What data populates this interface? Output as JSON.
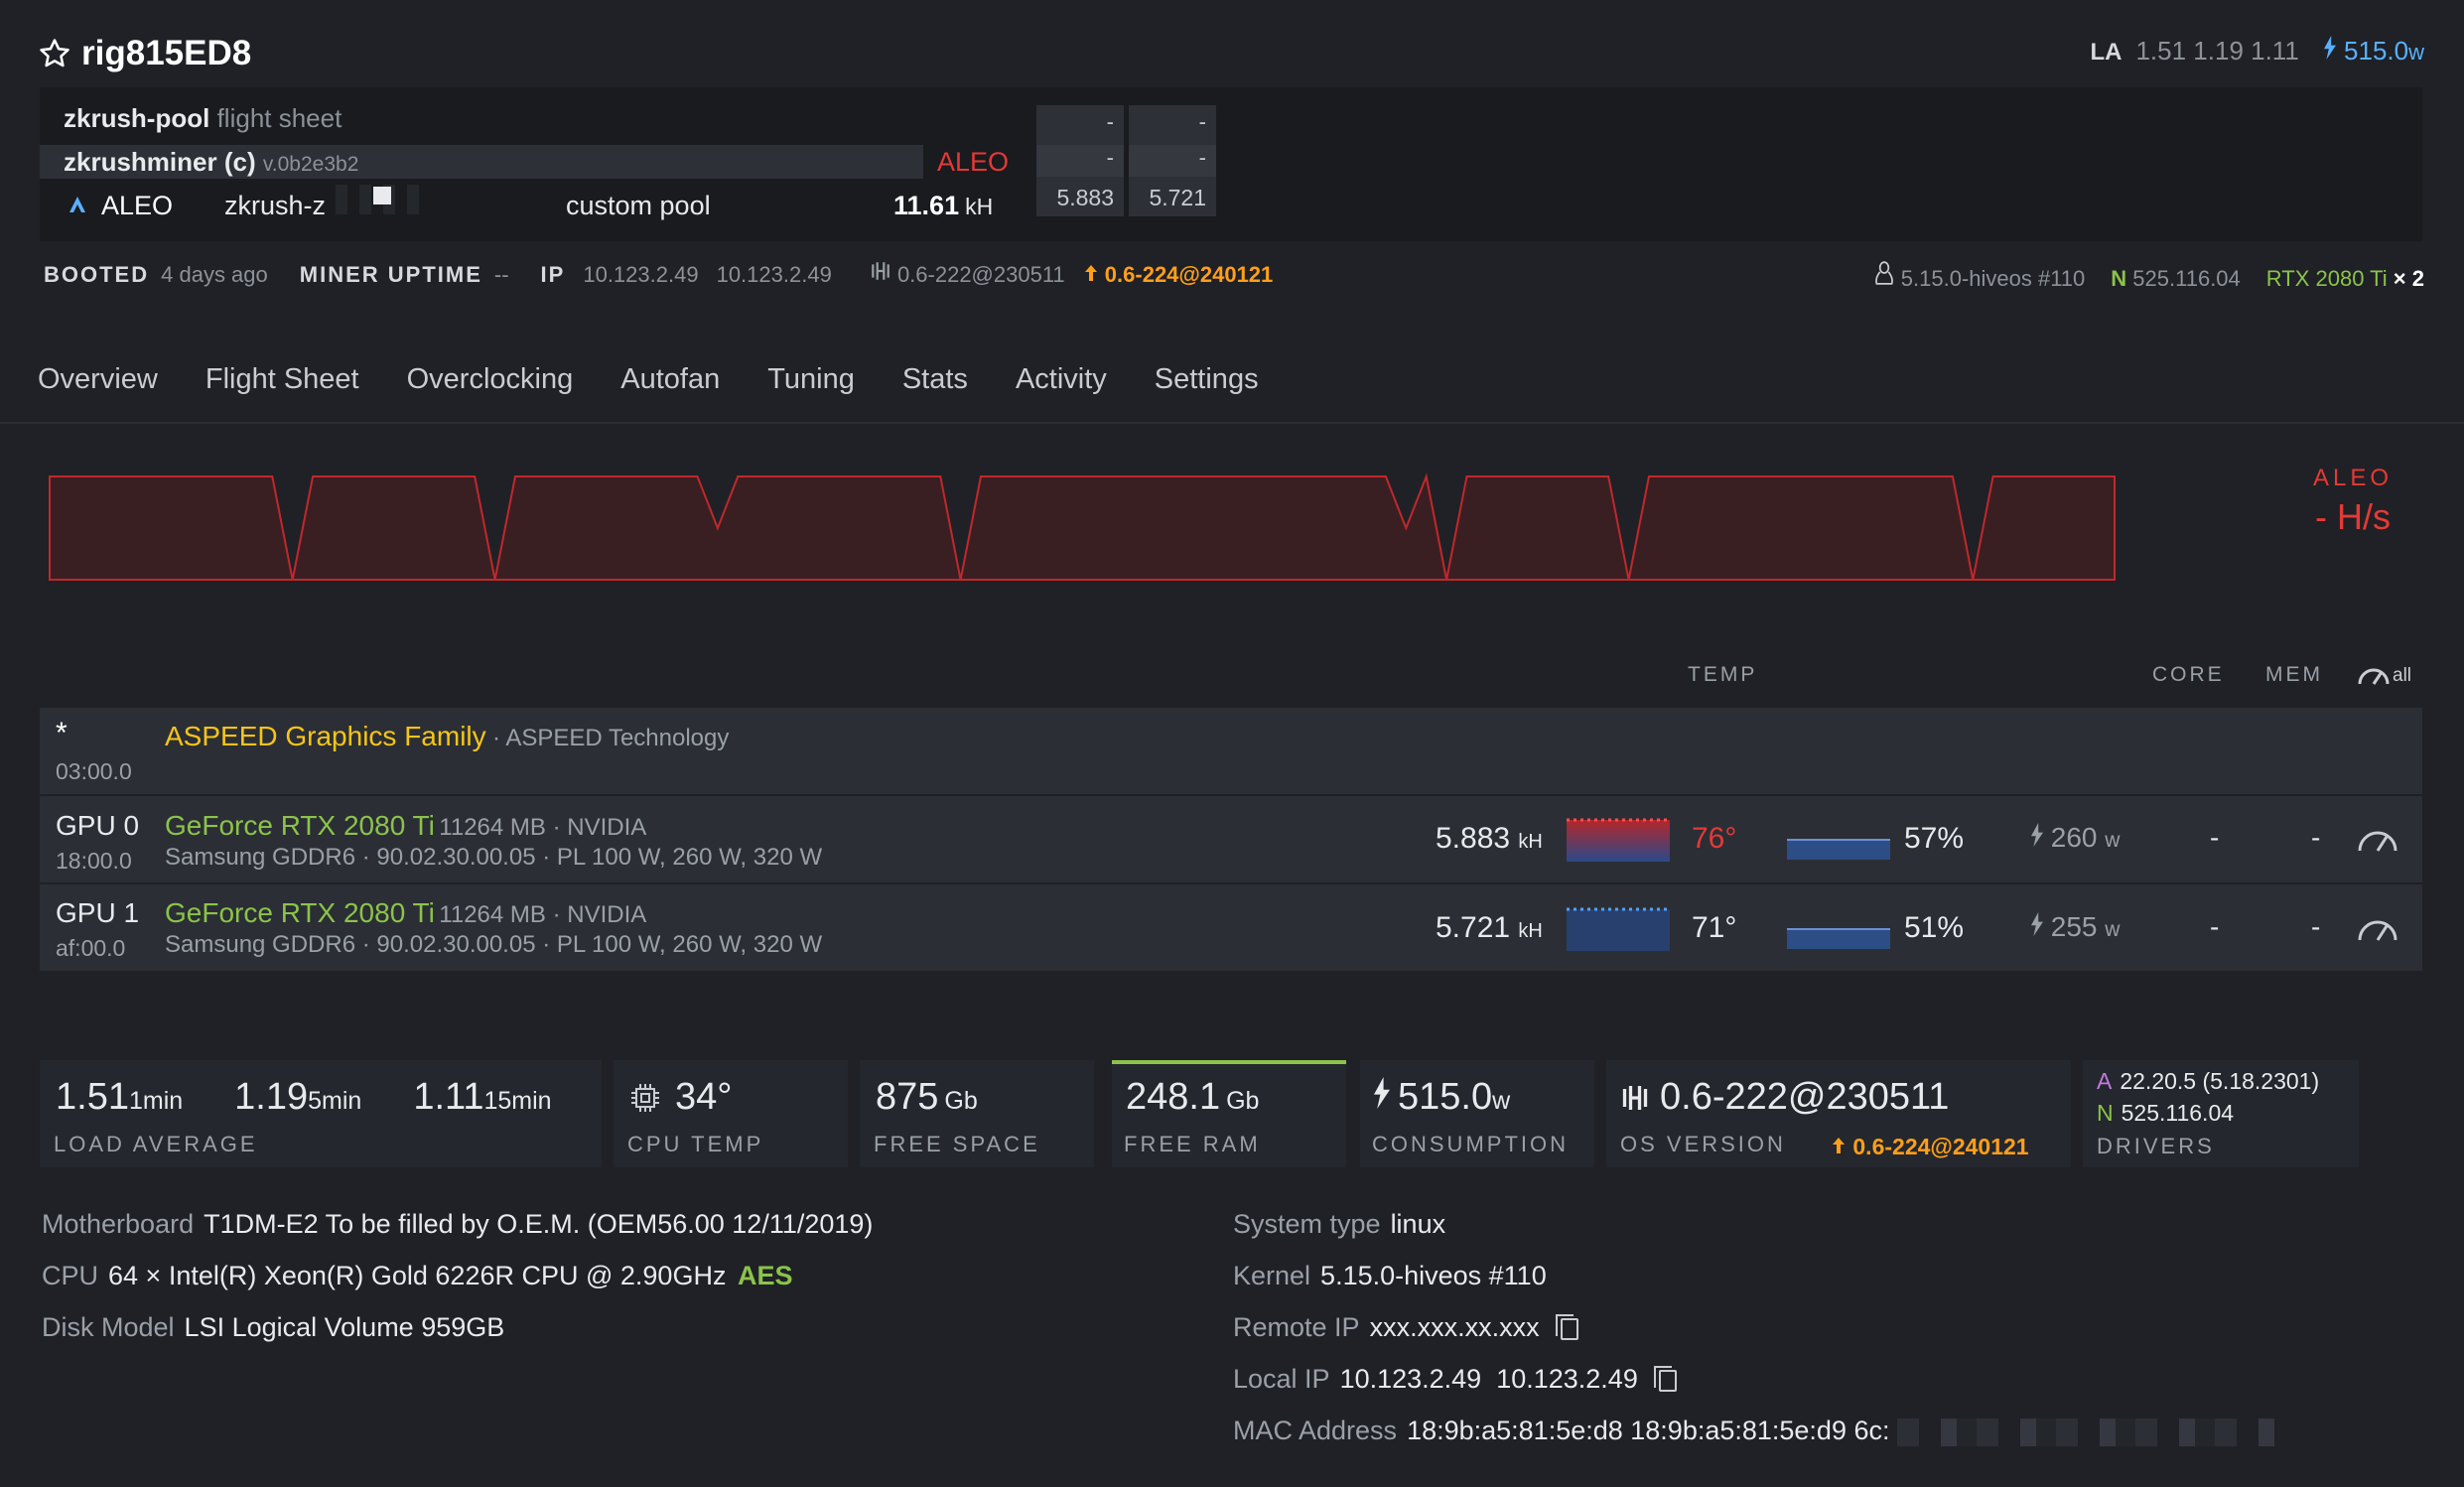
{
  "header": {
    "rig_name": "rig815ED8",
    "la_label": "LA",
    "la_values": "1.51 1.19 1.11",
    "power": "515.0",
    "power_unit": "w"
  },
  "flight_sheet": {
    "name": "zkrush-pool",
    "name_suffix": "flight sheet",
    "miner": "zkrushminer (c)",
    "miner_version": "v.0b2e3b2",
    "coin_tag": "ALEO",
    "coin": "ALEO",
    "wallet": "zkrush-z",
    "pool": "custom pool",
    "hashrate": "11.61",
    "hashrate_unit": "kH",
    "gpu_boxes": [
      {
        "top": "-",
        "mid": "-",
        "value": "5.883"
      },
      {
        "top": "-",
        "mid": "-",
        "value": "5.721"
      }
    ]
  },
  "status": {
    "booted_label": "BOOTED",
    "booted_value": "4 days ago",
    "uptime_label": "MINER UPTIME",
    "uptime_value": "--",
    "ip_label": "IP",
    "ip_value_1": "10.123.2.49",
    "ip_value_2": "10.123.2.49",
    "version": "0.6-222@230511",
    "version_upgrade": "0.6-224@240121",
    "kernel": "5.15.0-hiveos #110",
    "nvidia_driver": "525.116.04",
    "gpu_model": "RTX 2080 Ti",
    "gpu_count": "× 2"
  },
  "tabs": [
    "Overview",
    "Flight Sheet",
    "Overclocking",
    "Autofan",
    "Tuning",
    "Stats",
    "Activity",
    "Settings"
  ],
  "chart": {
    "coin": "ALEO",
    "current": "- H/s"
  },
  "chart_data": {
    "type": "area",
    "title": "",
    "series": [
      {
        "name": "ALEO",
        "values": [
          1,
          1,
          1,
          1,
          1,
          1,
          1,
          1,
          1,
          1,
          1,
          1,
          0,
          1,
          1,
          1,
          1,
          1,
          1,
          1,
          1,
          1,
          0,
          1,
          1,
          1,
          1,
          1,
          1,
          1,
          1,
          1,
          1,
          0.5,
          1,
          1,
          1,
          1,
          1,
          1,
          1,
          1,
          1,
          1,
          1,
          0,
          1,
          1,
          1,
          1,
          1,
          1,
          1,
          1,
          1,
          1,
          1,
          1,
          1,
          1,
          1,
          1,
          1,
          1,
          1,
          1,
          1,
          0.5,
          1,
          0,
          1,
          1,
          1,
          1,
          1,
          1,
          1,
          1,
          0,
          1,
          1,
          1,
          1,
          1,
          1,
          1,
          1,
          1,
          1,
          1,
          1,
          1,
          1,
          1,
          1,
          0,
          1,
          1,
          1,
          1,
          1,
          1,
          1
        ]
      }
    ]
  },
  "table": {
    "col_temp": "TEMP",
    "col_core": "CORE",
    "col_mem": "MEM",
    "all_label": "all"
  },
  "devices": [
    {
      "id": "*",
      "bus": "03:00.0",
      "name": "ASPEED Graphics Family",
      "vendor": "· ASPEED Technology"
    },
    {
      "id": "GPU 0",
      "bus": "18:00.0",
      "name": "GeForce RTX 2080 Ti",
      "mem": "11264 MB · NVIDIA",
      "details": "Samsung GDDR6 · 90.02.30.00.05 · PL 100 W, 260 W, 320 W",
      "hashrate": "5.883",
      "hash_unit": "kH",
      "temp": "76°",
      "temp_color": "#e53935",
      "fan": "57%",
      "power": "260",
      "power_unit": "w",
      "core": "-",
      "memclk": "-"
    },
    {
      "id": "GPU 1",
      "bus": "af:00.0",
      "name": "GeForce RTX 2080 Ti",
      "mem": "11264 MB · NVIDIA",
      "details": "Samsung GDDR6 · 90.02.30.00.05 · PL 100 W, 260 W, 320 W",
      "hashrate": "5.721",
      "hash_unit": "kH",
      "temp": "71°",
      "temp_color": "#e8eaed",
      "fan": "51%",
      "power": "255",
      "power_unit": "w",
      "core": "-",
      "memclk": "-"
    }
  ],
  "stats": {
    "la_1": "1.51",
    "la_1_unit": "1min",
    "la_5": "1.19",
    "la_5_unit": "5min",
    "la_15": "1.11",
    "la_15_unit": "15min",
    "la_caption": "LOAD AVERAGE",
    "cpu_temp": "34°",
    "cpu_temp_caption": "CPU TEMP",
    "free_space": "875",
    "free_space_unit": "Gb",
    "free_space_caption": "FREE SPACE",
    "free_ram": "248.1",
    "free_ram_unit": "Gb",
    "free_ram_caption": "FREE RAM",
    "consumption": "515.0",
    "consumption_unit": "w",
    "consumption_caption": "CONSUMPTION",
    "os_version": "0.6-222@230511",
    "os_upgrade": "0.6-224@240121",
    "os_caption": "OS VERSION",
    "drv_amd_letter": "A",
    "drv_amd": "22.20.5 (5.18.2301)",
    "drv_nv_letter": "N",
    "drv_nv": "525.116.04",
    "drivers_caption": "DRIVERS"
  },
  "info": {
    "motherboard_label": "Motherboard",
    "motherboard": "T1DM-E2 To be filled by O.E.M. (OEM56.00 12/11/2019)",
    "cpu_label": "CPU",
    "cpu": "64 × Intel(R) Xeon(R) Gold 6226R CPU @ 2.90GHz",
    "cpu_flag": "AES",
    "disk_label": "Disk Model",
    "disk": "LSI Logical Volume 959GB",
    "system_type_label": "System type",
    "system_type": "linux",
    "kernel_label": "Kernel",
    "kernel": "5.15.0-hiveos #110",
    "remote_ip_label": "Remote IP",
    "remote_ip": "xxx.xxx.xx.xxx",
    "local_ip_label": "Local IP",
    "local_ip": "10.123.2.49  10.123.2.49",
    "mac_label": "MAC Address",
    "mac": "18:9b:a5:81:5e:d8 18:9b:a5:81:5e:d9 6c:"
  },
  "colors": {
    "accent_red": "#e53935",
    "accent_orange": "#ff9f1a",
    "accent_green": "#8bc34a",
    "accent_yellow": "#f5c518",
    "accent_blue": "#5ab0ff"
  }
}
